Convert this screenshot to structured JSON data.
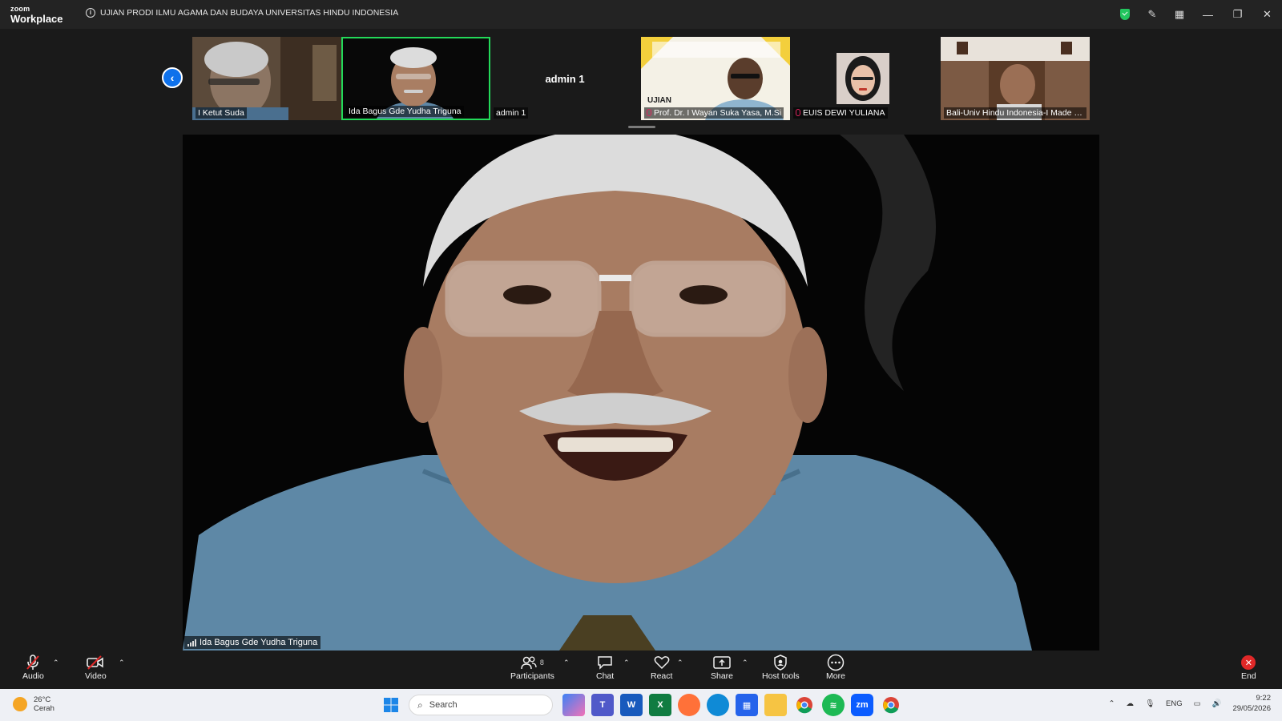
{
  "app": {
    "brand_top": "zoom",
    "brand_bottom": "Workplace",
    "meeting_title": "UJIAN  PRODI  ILMU AGAMA  DAN BUDAYA UNIVERSITAS HINDU INDONESIA"
  },
  "strip": {
    "tiles": [
      {
        "name": "I Ketut Suda",
        "muted": false
      },
      {
        "name": "Ida Bagus Gde Yudha Triguna",
        "muted": false,
        "active": true
      },
      {
        "name": "admin 1",
        "center_text": "admin 1",
        "muted": false
      },
      {
        "name": "Prof. Dr. I Wayan Suka Yasa, M.Si",
        "slide_text": "UJIAN",
        "muted": true
      },
      {
        "name": "EUIS DEWI YULIANA",
        "muted": true
      },
      {
        "name": "Bali-Univ Hindu Indonesia-I Made S...",
        "muted": false
      }
    ]
  },
  "main": {
    "speaker_name": "Ida Bagus Gde Yudha Triguna"
  },
  "toolbar": {
    "audio_label": "Audio",
    "video_label": "Video",
    "participants_label": "Participants",
    "participants_count": "8",
    "chat_label": "Chat",
    "react_label": "React",
    "share_label": "Share",
    "host_tools_label": "Host tools",
    "more_label": "More",
    "end_label": "End"
  },
  "taskbar": {
    "temperature": "26°C",
    "weather": "Cerah",
    "search_placeholder": "Search",
    "language": "ENG",
    "time": "9:22",
    "date": "29/05/2026"
  },
  "colors": {
    "active_border": "#23d959",
    "end_red": "#e02828",
    "zoom_blue": "#0e71eb",
    "muted_red": "#e0245e"
  }
}
